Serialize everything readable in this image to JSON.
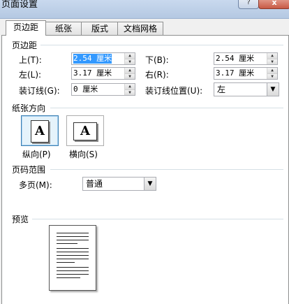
{
  "window": {
    "title": "页面设置",
    "help_label": "?",
    "close_label": "x"
  },
  "tabs": [
    "页边距",
    "纸张",
    "版式",
    "文档网格"
  ],
  "margins": {
    "section_label": "页边距",
    "top_label": "上(T):",
    "top_value": "2.54 厘米",
    "bottom_label": "下(B):",
    "bottom_value": "2.54 厘米",
    "left_label": "左(L):",
    "left_value": "3.17 厘米",
    "right_label": "右(R):",
    "right_value": "3.17 厘米",
    "gutter_label": "装订线(G):",
    "gutter_value": "0 厘米",
    "gutter_pos_label": "装订线位置(U):",
    "gutter_pos_value": "左"
  },
  "orientation": {
    "section_label": "纸张方向",
    "icon_letter": "A",
    "portrait_label": "纵向(P)",
    "landscape_label": "横向(S)",
    "selected": "portrait"
  },
  "pages": {
    "section_label": "页码范围",
    "multiple_label": "多页(M):",
    "multiple_value": "普通"
  },
  "preview": {
    "section_label": "预览"
  },
  "colors": {
    "selection": "#3399ff",
    "group_line": "#d5dfe5"
  }
}
